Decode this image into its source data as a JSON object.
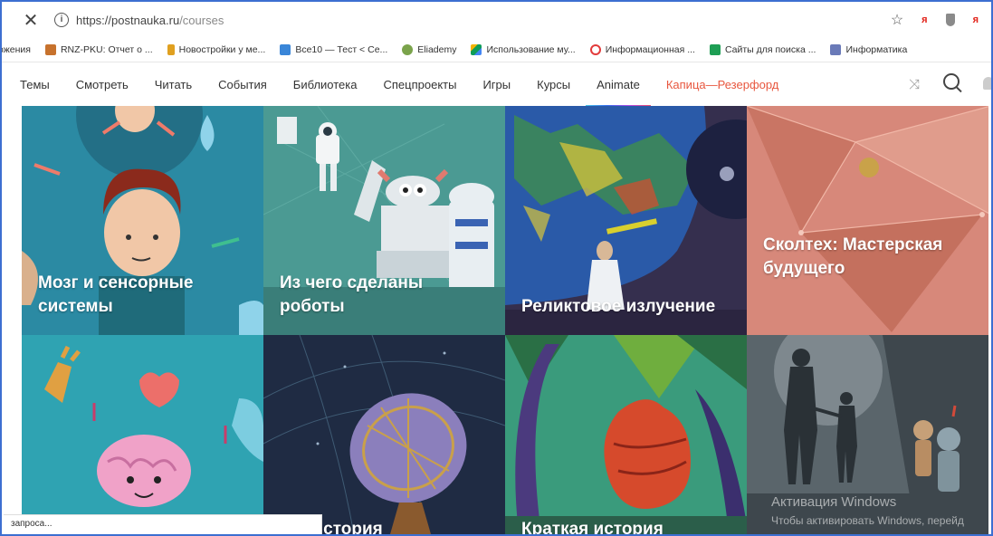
{
  "browser": {
    "url_domain": "https://postnauka.ru",
    "url_path": "/courses",
    "close_glyph": "✕",
    "star_glyph": "☆",
    "ya_glyph": "я"
  },
  "bookmarks": [
    {
      "label": "ожения",
      "icon": "none",
      "color": ""
    },
    {
      "label": "RNZ-PKU: Отчет о ...",
      "icon": "rnz-icon",
      "color": "#c7722d"
    },
    {
      "label": "Новостройки у ме...",
      "icon": "lamp-icon",
      "color": "#e0a020"
    },
    {
      "label": "Все10 — Тест < Се...",
      "icon": "ten-icon",
      "color": "#3a86d8"
    },
    {
      "label": "Eliademy",
      "icon": "eliademy-icon",
      "color": "#7aa34b"
    },
    {
      "label": "Использование му...",
      "icon": "drive-icon",
      "color": "#f4b400"
    },
    {
      "label": "Информационная ...",
      "icon": "ring-icon",
      "color": "#e23b3b"
    },
    {
      "label": "Сайты для поиска ...",
      "icon": "sheet-icon",
      "color": "#1e9e54"
    },
    {
      "label": "Информатика",
      "icon": "puzzle-icon",
      "color": "#6a7ab8"
    }
  ],
  "nav": {
    "items": [
      "Темы",
      "Смотреть",
      "Читать",
      "События",
      "Библиотека",
      "Спецпроекты",
      "Игры",
      "Курсы",
      "Animate",
      "Капица—Резерфорд"
    ],
    "active": "Капица—Резерфорд",
    "shuffle_glyph": "⤨"
  },
  "courses": [
    {
      "title": "Мозг и сенсорные системы",
      "icon": "brain-course-art"
    },
    {
      "title": "Из чего сделаны роботы",
      "icon": "robots-course-art"
    },
    {
      "title": "Реликтовое излучение",
      "icon": "cmb-course-art"
    },
    {
      "title": "Сколтех: Мастерская будущего",
      "icon": "skoltech-course-art"
    },
    {
      "title": "",
      "icon": "brain-cartoon-art"
    },
    {
      "title": "кая история",
      "icon": "telescope-art"
    },
    {
      "title": "Краткая история",
      "icon": "jungle-art"
    },
    {
      "title": "",
      "icon": "robots-silhouette-art"
    }
  ],
  "status_bar": {
    "text": "запроса..."
  },
  "watermark": {
    "line1": "Активация Windows",
    "line2": "Чтобы активировать Windows, перейд"
  },
  "colors": {
    "accent": "#e8573f",
    "frame": "#3d6fd1"
  }
}
